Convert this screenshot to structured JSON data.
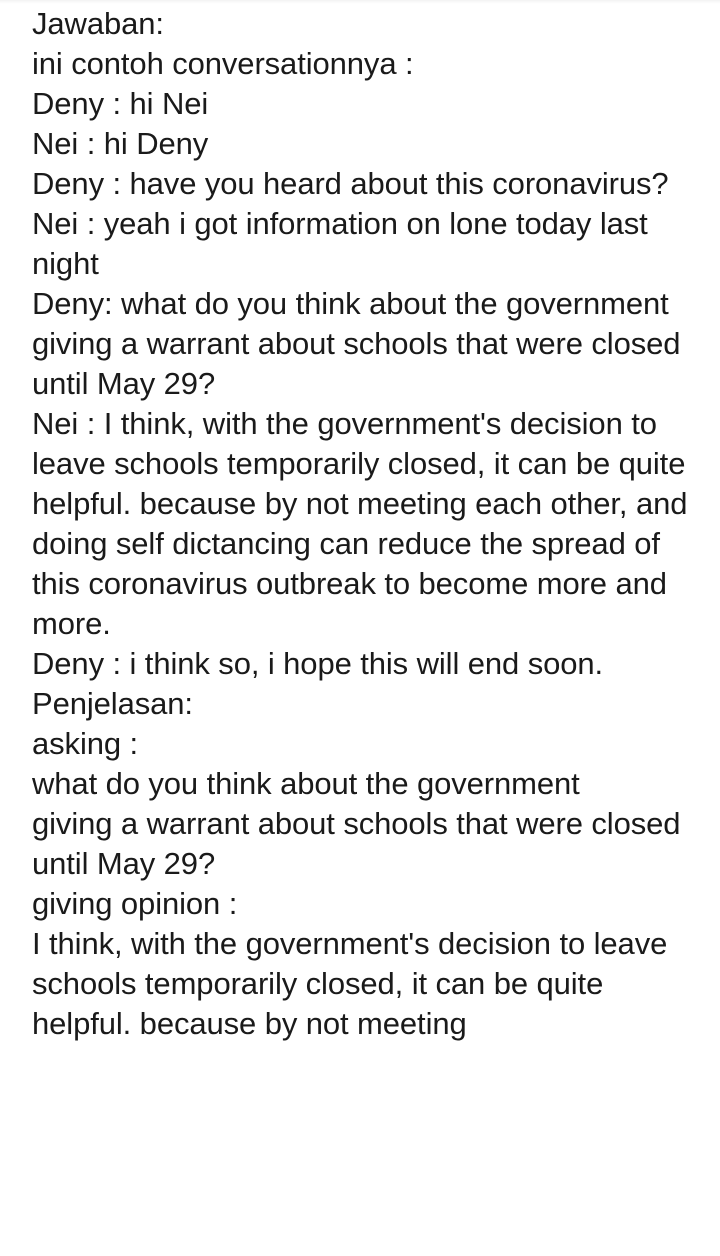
{
  "document": {
    "heading": "Jawaban:",
    "intro": "ini contoh conversationnya :",
    "conversation": [
      "Deny : hi Nei",
      "Nei : hi Deny",
      "Deny : have you heard about this coronavirus?",
      "Nei : yeah i got information on lone today last",
      "night",
      "Deny: what do you think about the government",
      "giving a warrant about schools that were closed until May 29?",
      "Nei : I think, with the government's decision to leave schools temporarily closed, it can be quite helpful. because by not meeting each other, and doing self dictancing can reduce the spread of this coronavirus outbreak to become more and more.",
      "Deny : i think so, i hope this will end soon."
    ],
    "explanation_heading": "Penjelasan:",
    "asking_label": "asking :",
    "asking_text_line_1": "what do you think about the government",
    "asking_text_line_2": "giving a warrant about schools that were closed until May 29?",
    "opinion_label": "giving opinion :",
    "opinion_text": "I think, with the government's decision to leave schools temporarily closed, it can be quite helpful. because by not meeting"
  }
}
